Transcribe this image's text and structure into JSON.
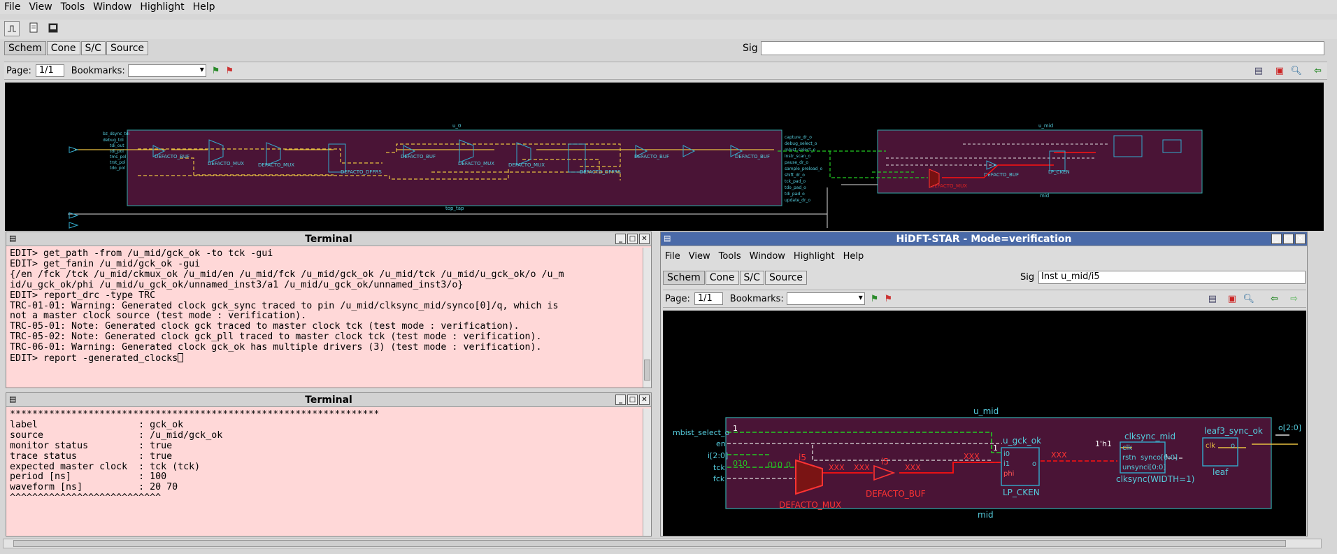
{
  "menu": [
    "File",
    "View",
    "Tools",
    "Window",
    "Highlight",
    "Help"
  ],
  "tabs": [
    "Schem",
    "Cone",
    "S/C",
    "Source"
  ],
  "sig_label": "Sig",
  "main_sig_value": "",
  "page_label": "Page:",
  "page_value": "1/1",
  "bookmarks_label": "Bookmarks:",
  "terminal1": {
    "title": "Terminal",
    "lines": [
      "EDIT> get_path -from /u_mid/gck_ok -to tck -gui",
      "EDIT> get_fanin /u_mid/gck_ok -gui",
      "{/en /fck /tck /u_mid/ckmux_ok /u_mid/en /u_mid/fck /u_mid/gck_ok /u_mid/tck /u_mid/u_gck_ok/o /u_m",
      "id/u_gck_ok/phi /u_mid/u_gck_ok/unnamed_inst3/a1 /u_mid/u_gck_ok/unnamed_inst3/o}",
      "EDIT> report_drc -type TRC",
      "TRC-01-01: Warning: Generated clock gck_sync traced to pin /u_mid/clksync_mid/synco[0]/q, which is",
      "not a master clock source (test mode : verification).",
      "TRC-05-01: Note: Generated clock gck traced to master clock tck (test mode : verification).",
      "TRC-05-02: Note: Generated clock gck_pll traced to master clock tck (test mode : verification).",
      "TRC-06-01: Warning: Generated clock gck_ok has multiple drivers (3) (test mode : verification).",
      "EDIT> report -generated_clocks"
    ]
  },
  "terminal2": {
    "title": "Terminal",
    "lines": [
      "******************************************************************",
      "label                  : gck_ok",
      "source                 : /u_mid/gck_ok",
      "monitor status         : true",
      "trace status           : true",
      "expected master clock  : tck (tck)",
      "period [ns]            : 100",
      "waveform [ns]          : 20 70",
      "",
      "^^^^^^^^^^^^^^^^^^^^^^^^^^^"
    ]
  },
  "hidft": {
    "title": "HiDFT-STAR - Mode=verification",
    "sig_value": "Inst u_mid/i5"
  },
  "top_schematic": {
    "module_u0": "u_0",
    "module_umid": "u_mid",
    "label_top_tap": "top_tap",
    "label_mid": "mid",
    "cells": [
      "DEFACTO_BUF",
      "DEFACTO_MUX",
      "DEFACTO_MUX",
      "DEFACTO_DFFRS",
      "DEFACTO_BUF",
      "DEFACTO_MUX",
      "DEFACTO_MUX",
      "DEFACTO_DFFRS",
      "DEFACTO_BUF",
      "DEFACTO_BUF",
      "DEFACTO_MUX",
      "DEFACTO_BUF",
      "LP_CKEN"
    ]
  },
  "zoom_schematic": {
    "module": "u_mid",
    "module_bottom": "mid",
    "inputs": [
      "mbist_select_o",
      "en",
      "i[2:0]",
      "tck",
      "fck"
    ],
    "output": "o[2:0]",
    "mux_label": "DEFACTO_MUX",
    "mux_inst": "i5",
    "buf_label": "DEFACTO_BUF",
    "buf_inst": "i5",
    "cken_inst": "u_gck_ok",
    "cken_label": "LP_CKEN",
    "cken_pins": [
      "i0",
      "i1",
      "phi",
      "o"
    ],
    "sync_inst": "clksync_mid",
    "sync_label": "clksync(WIDTH=1)",
    "sync_pins": [
      "clk",
      "rstn",
      "synco[0:0]",
      "unsynci[0:0]"
    ],
    "sync_const": "1'h1",
    "leaf_inst": "leaf3_sync_ok",
    "leaf_label": "leaf",
    "leaf_pins": [
      "clk",
      "o"
    ],
    "xxx": "XXX",
    "val_010": "010",
    "val_1": "1",
    "val_0": "0"
  },
  "colors": {
    "module_fill": "#4a1436",
    "module_border": "#33aaaa",
    "wire_red": "#ff1111",
    "wire_yellow": "#e8c040",
    "wire_green": "#22cc22",
    "text_cyan": "#55ccdd"
  }
}
